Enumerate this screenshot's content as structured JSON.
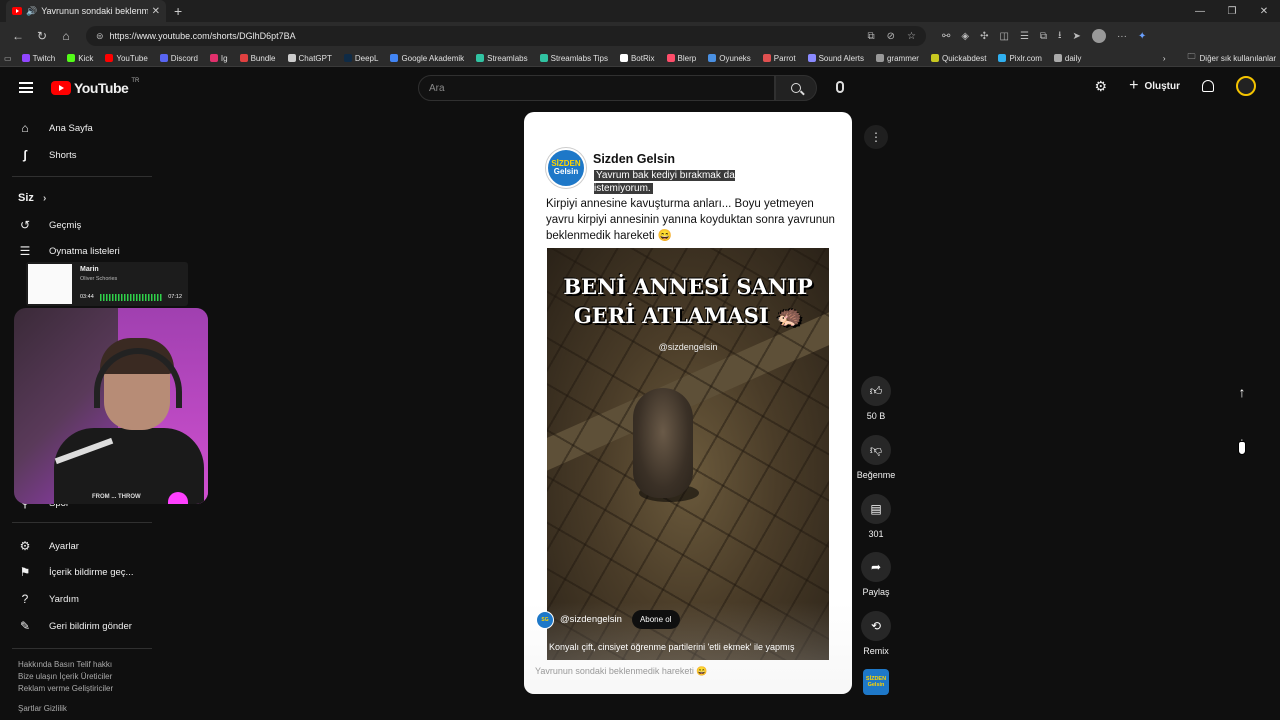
{
  "browser": {
    "tab_title": "Yavrunun sondaki beklenme",
    "url": "https://www.youtube.com/shorts/DGlhD6pt7BA",
    "bookmarks": [
      {
        "label": "Twitch",
        "color": "#9146ff"
      },
      {
        "label": "Kick",
        "color": "#53fc18"
      },
      {
        "label": "YouTube",
        "color": "#ff0000"
      },
      {
        "label": "Discord",
        "color": "#5865f2"
      },
      {
        "label": "Ig",
        "color": "#e1306c"
      },
      {
        "label": "Bundle",
        "color": "#e04040"
      },
      {
        "label": "ChatGPT",
        "color": "#cccccc"
      },
      {
        "label": "DeepL",
        "color": "#0f2b46"
      },
      {
        "label": "Google Akademik",
        "color": "#4285f4"
      },
      {
        "label": "Streamlabs",
        "color": "#31c3a2"
      },
      {
        "label": "Streamlabs Tips",
        "color": "#31c3a2"
      },
      {
        "label": "BotRix",
        "color": "#ffffff"
      },
      {
        "label": "Blerp",
        "color": "#ff4d6a"
      },
      {
        "label": "Oyuneks",
        "color": "#4a90e2"
      },
      {
        "label": "Parrot",
        "color": "#e05050"
      },
      {
        "label": "Sound Alerts",
        "color": "#8a8aff"
      },
      {
        "label": "grammer",
        "color": "#999999"
      },
      {
        "label": "Quickabdest",
        "color": "#c8c820"
      },
      {
        "label": "Pixlr.com",
        "color": "#30b0f0"
      },
      {
        "label": "daily",
        "color": "#aaaaaa"
      }
    ],
    "other_bookmarks": "Diğer sık kullanılanlar"
  },
  "header": {
    "logo_text": "YouTube",
    "logo_country": "TR",
    "search_placeholder": "Ara",
    "create_label": "Oluştur"
  },
  "sidebar": {
    "home": "Ana Sayfa",
    "shorts": "Shorts",
    "you": "Siz",
    "history": "Geçmiş",
    "playlists": "Oynatma listeleri",
    "sport": "Spor",
    "settings": "Ayarlar",
    "report": "İçerik bildirme geç...",
    "help": "Yardım",
    "feedback": "Geri bildirim gönder",
    "footer1": "Hakkında  Basın  Telif hakkı",
    "footer2": "Bize ulaşın  İçerik Üreticiler",
    "footer3": "Reklam verme  Geliştiriciler",
    "footer4": "Şartlar  Gizlilik"
  },
  "music_widget": {
    "title": "Marin",
    "artist": "Oliver Schories",
    "elapsed": "03:44",
    "total": "07:12"
  },
  "webcam": {
    "shirt_text": "FROM ... THROW"
  },
  "short": {
    "channel_name": "Sizden Gelsin",
    "channel_logo_top": "SİZDEN",
    "channel_logo_bottom": "Gelsin",
    "subtitle": "Yavrum bak kediyi bırakmak da istemiyorum.",
    "caption": "Kirpiyi annesine kavuşturma anları... Boyu yetmeyen yavru kirpiyi annesinin yanına koyduktan sonra yavrunun beklenmedik hareketi 😄",
    "video_text": "BENİ ANNESİ SANIP GERİ ATLAMASI 🦔",
    "video_handle": "@sizdengelsin",
    "overlay_handle": "@sizdengelsin",
    "subscribe_label": "Abone ol",
    "music_line": "Konyalı çift, cinsiyet öğrenme partilerini 'etli ekmek' ile yapmış",
    "title": "Yavrunun sondaki beklenmedik hareketi 😄"
  },
  "actions": {
    "likes": "50 B",
    "dislike": "Beğenme",
    "comments": "301",
    "share": "Paylaş",
    "remix": "Remix"
  },
  "colors": {
    "background": "#0f0f0f",
    "youtube_red": "#ff0000",
    "channel_blue": "#1e78c8"
  }
}
